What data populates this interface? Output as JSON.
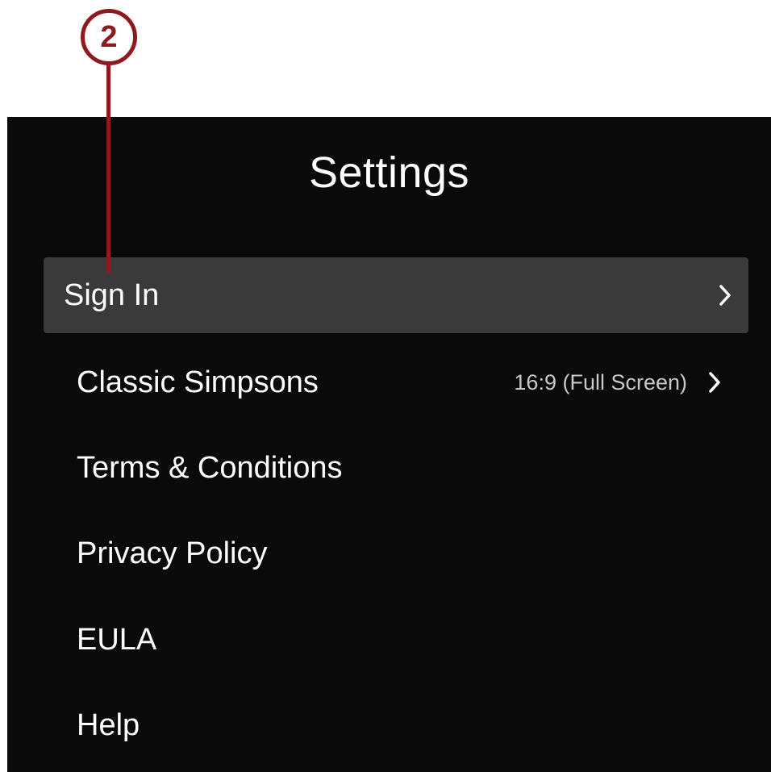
{
  "callout": {
    "number": "2",
    "color": "#8e1a20"
  },
  "screen": {
    "title": "Settings",
    "background": "#0a0a0a",
    "focus_color": "#3a3a3a",
    "items": [
      {
        "label": "Sign In",
        "value": "",
        "chevron": "chevron-right-icon",
        "focused": true
      },
      {
        "label": "Classic Simpsons",
        "value": "16:9 (Full Screen)",
        "chevron": "chevron-right-icon",
        "focused": false
      },
      {
        "label": "Terms & Conditions",
        "value": "",
        "chevron": "",
        "focused": false
      },
      {
        "label": "Privacy Policy",
        "value": "",
        "chevron": "",
        "focused": false
      },
      {
        "label": "EULA",
        "value": "",
        "chevron": "",
        "focused": false
      },
      {
        "label": "Help",
        "value": "",
        "chevron": "",
        "focused": false
      }
    ]
  }
}
